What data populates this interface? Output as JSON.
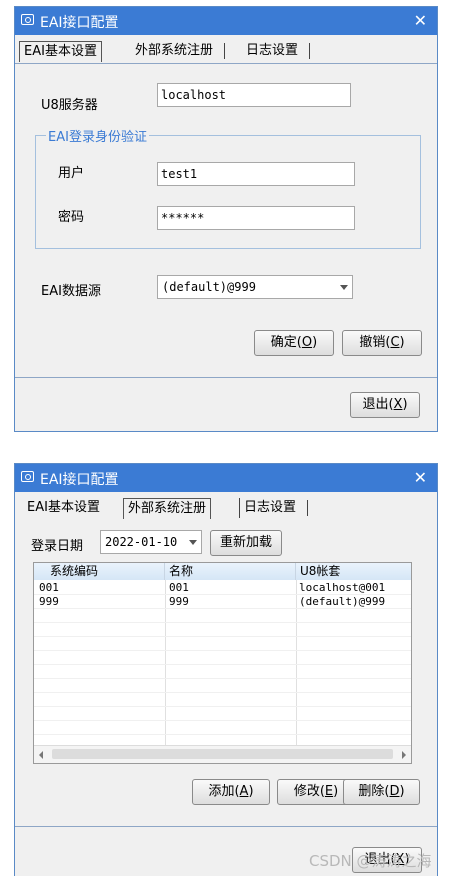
{
  "window1": {
    "title": "EAI接口配置",
    "tabs": [
      "EAI基本设置",
      "外部系统注册",
      "日志设置"
    ],
    "u8_server_label": "U8服务器",
    "u8_server_value": "localhost",
    "group_title": "EAI登录身份验证",
    "user_label": "用户",
    "user_value": "test1",
    "password_label": "密码",
    "password_value": "******",
    "datasource_label": "EAI数据源",
    "datasource_value": "(default)@999",
    "ok_button": {
      "text": "确定(",
      "key": "O",
      "end": ")"
    },
    "cancel_button": {
      "text": "撤销(",
      "key": "C",
      "end": ")"
    },
    "exit_button": {
      "text": "退出(",
      "key": "X",
      "end": ")"
    }
  },
  "window2": {
    "title": "EAI接口配置",
    "tabs": [
      "EAI基本设置",
      "外部系统注册",
      "日志设置"
    ],
    "login_date_label": "登录日期",
    "login_date_value": "2022-01-10",
    "reload_button": "重新加载",
    "columns": [
      "系统编码",
      "名称",
      "U8帐套"
    ],
    "rows": [
      [
        "001",
        "001",
        "localhost@001"
      ],
      [
        "999",
        "999",
        "(default)@999"
      ]
    ],
    "add_button": {
      "text": "添加(",
      "key": "A",
      "end": ")"
    },
    "modify_button": {
      "text": "修改(",
      "key": "E",
      "end": ")"
    },
    "delete_button": {
      "text": "删除(",
      "key": "D",
      "end": ")"
    },
    "exit_button": {
      "text": "退出(",
      "key": "X",
      "end": ")"
    }
  },
  "watermark": "CSDN @涛涛之海"
}
